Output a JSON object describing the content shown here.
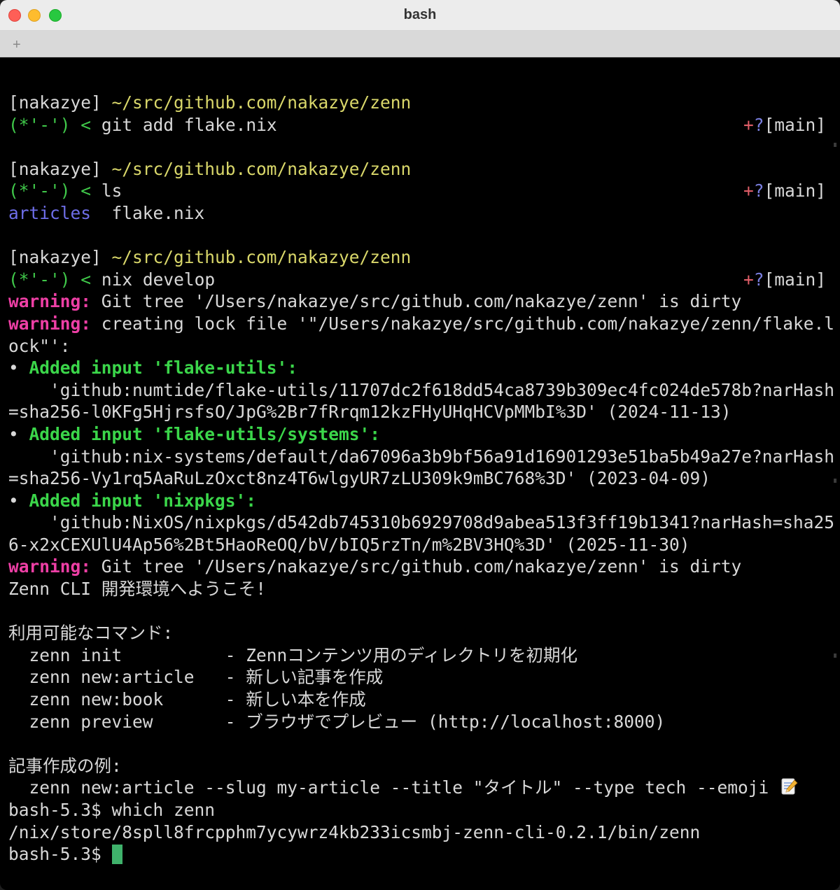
{
  "window": {
    "title": "bash",
    "new_tab_label": "+"
  },
  "prompt": {
    "user": "[nakazye]",
    "path": "~/src/github.com/nakazye/zenn",
    "face": "(*'-')",
    "arrow": "<",
    "git_plus": "+",
    "git_q": "?",
    "git_branch": "[main]"
  },
  "commands": {
    "cmd1": "git add flake.nix",
    "cmd2": "ls",
    "cmd3": "nix develop"
  },
  "ls_output": {
    "dir": "articles",
    "file": "flake.nix"
  },
  "nix_output": {
    "warn_label": "warning:",
    "warn1": "Git tree '/Users/nakazye/src/github.com/nakazye/zenn' is dirty",
    "warn2a": "creating lock file '\"/Users/nakazye/src/github.com/nakazye/zenn/flake.l",
    "warn2b": "ock\"':",
    "bullet": "•",
    "added1": "Added input 'flake-utils':",
    "added1_l1": "    'github:numtide/flake-utils/11707dc2f618dd54ca8739b309ec4fc024de578b?narHash",
    "added1_l2": "=sha256-l0KFg5HjrsfsO/JpG%2Br7fRrqm12kzFHyUHqHCVpMMbI%3D' (2024-11-13)",
    "added2": "Added input 'flake-utils/systems':",
    "added2_l1": "    'github:nix-systems/default/da67096a3b9bf56a91d16901293e51ba5b49a27e?narHash",
    "added2_l2": "=sha256-Vy1rq5AaRuLzOxct8nz4T6wlgyUR7zLU309k9mBC768%3D' (2023-04-09)",
    "added3": "Added input 'nixpkgs':",
    "added3_l1": "    'github:NixOS/nixpkgs/d542db745310b6929708d9abea513f3ff19b1341?narHash=sha25",
    "added3_l2": "6-x2xCEXUlU4Ap56%2Bt5HaoReOQ/bV/bIQ5rzTn/m%2BV3HQ%3D' (2025-11-30)",
    "warn3": "Git tree '/Users/nakazye/src/github.com/nakazye/zenn' is dirty"
  },
  "shell_hook": {
    "welcome": "Zenn CLI 開発環境へようこそ!",
    "commands_header": "利用可能なコマンド:",
    "cmd_rows": [
      "  zenn init          - Zennコンテンツ用のディレクトリを初期化",
      "  zenn new:article   - 新しい記事を作成",
      "  zenn new:book      - 新しい本を作成",
      "  zenn preview       - ブラウザでプレビュー (http://localhost:8000)"
    ],
    "example_header": "記事作成の例:",
    "example": "  zenn new:article --slug my-article --title \"タイトル\" --type tech --emoji "
  },
  "bash_session": {
    "ps1": "bash-5.3$ ",
    "which_cmd": "which zenn",
    "which_result": "/nix/store/8spll8frcpphm7ycywrz4kb233icsmbj-zenn-cli-0.2.1/bin/zenn"
  },
  "colors": {
    "path": "#d9d76a",
    "face": "#40c94a",
    "warning": "#ee3fa5",
    "added": "#3bd64a",
    "dir": "#6e6ee8",
    "cursor": "#3fb26b"
  }
}
